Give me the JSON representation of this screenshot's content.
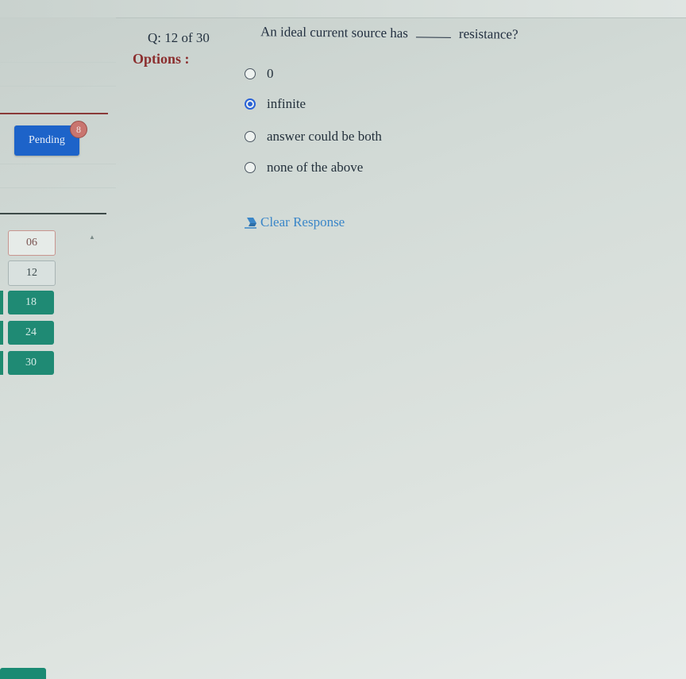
{
  "question": {
    "number_label": "Q: 12 of 30",
    "text_before_blank": "An ideal current source has",
    "text_after_blank": "resistance?",
    "options_label": "Options :",
    "options": [
      {
        "label": "0",
        "selected": false
      },
      {
        "label": "infinite",
        "selected": true
      },
      {
        "label": "answer could be both",
        "selected": false
      },
      {
        "label": "none of the above",
        "selected": false
      }
    ],
    "clear_response_label": "Clear Response"
  },
  "sidebar": {
    "pending_label": "Pending",
    "pending_count": "8",
    "question_groups": [
      {
        "label": "06",
        "state": "outline-red"
      },
      {
        "label": "12",
        "state": "outline-gray"
      },
      {
        "label": "18",
        "state": "green"
      },
      {
        "label": "24",
        "state": "green"
      },
      {
        "label": "30",
        "state": "green"
      }
    ]
  },
  "colors": {
    "pending_blue": "#1d63c9",
    "answered_green": "#1f8a74",
    "options_red": "#8b2e2e",
    "radio_selected": "#2a62d6",
    "link_blue": "#3a86c8"
  }
}
